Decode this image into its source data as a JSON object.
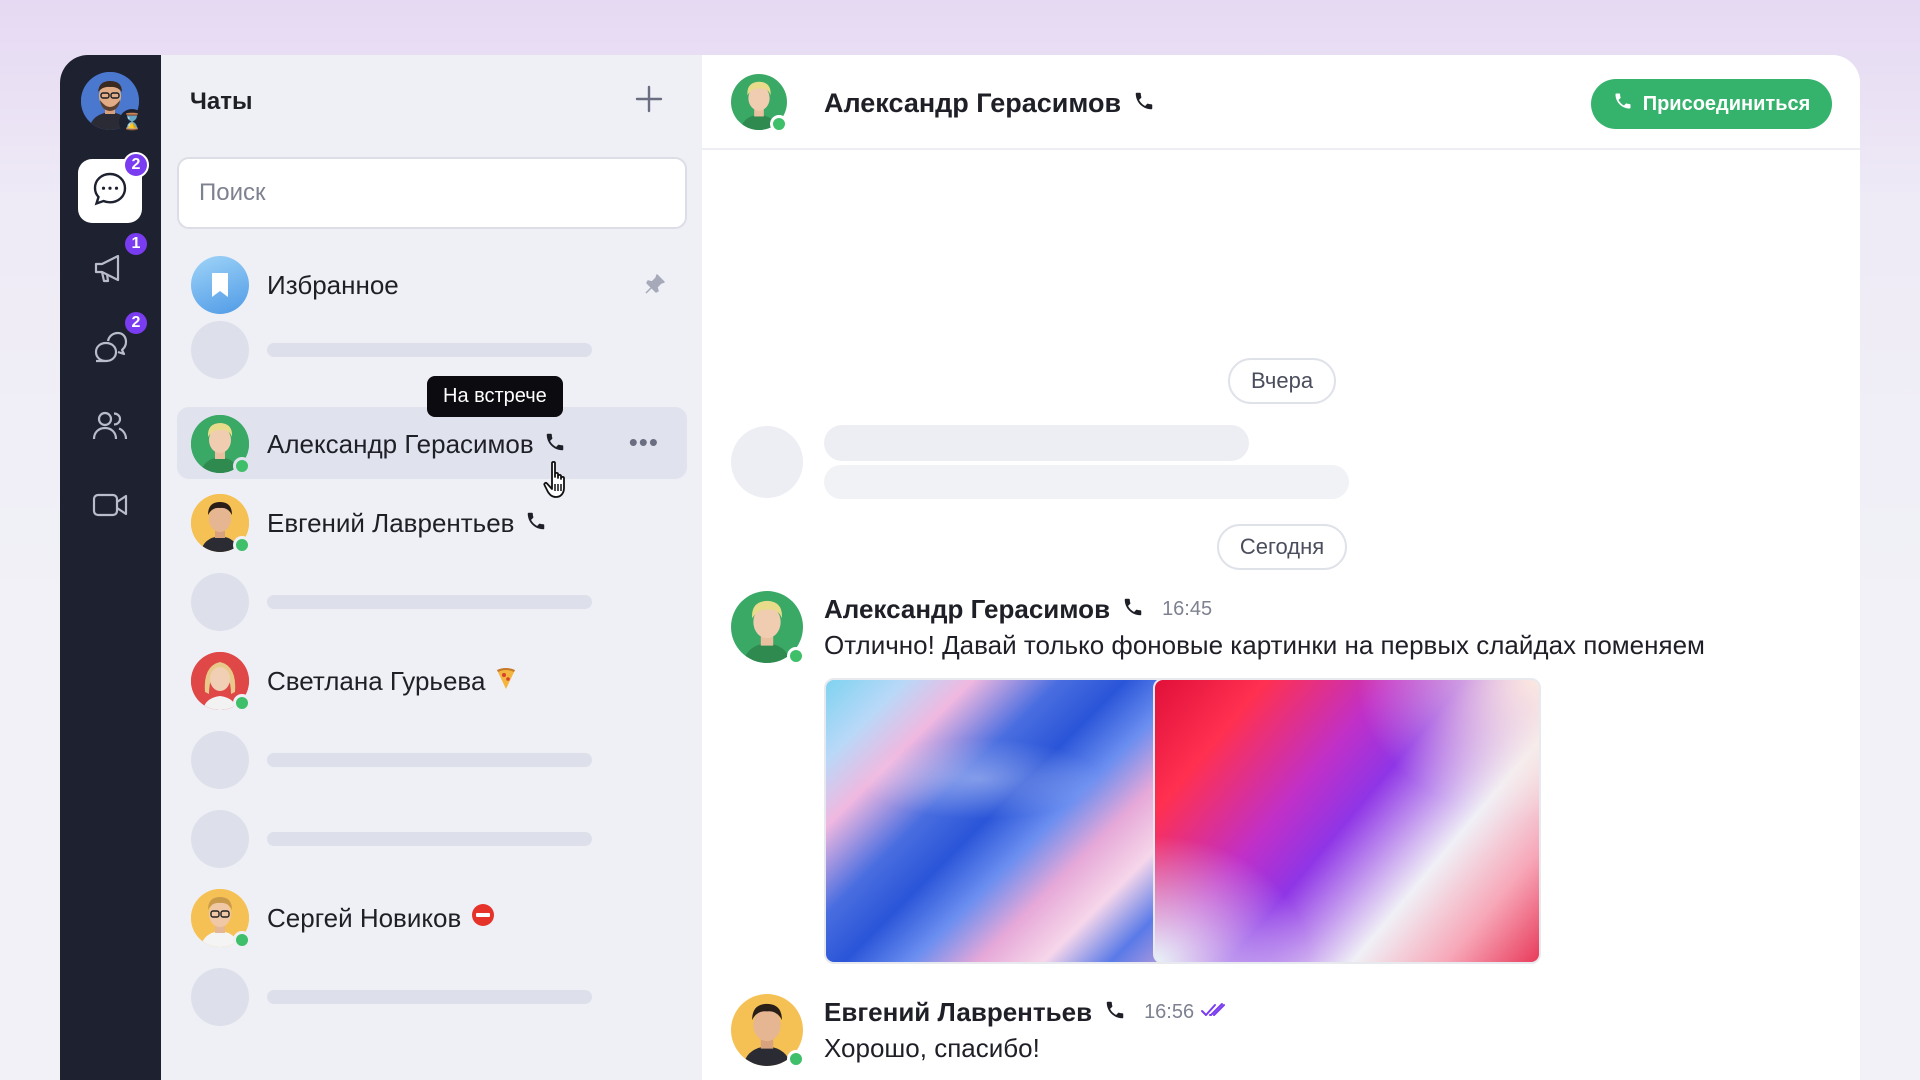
{
  "rail": {
    "avatar_status_icon": "hourglass-icon",
    "items": [
      {
        "icon": "chat-bubble-icon",
        "badge": "2",
        "active": true
      },
      {
        "icon": "megaphone-icon",
        "badge": "1",
        "active": false
      },
      {
        "icon": "threads-icon",
        "badge": "2",
        "active": false
      },
      {
        "icon": "contacts-icon",
        "badge": "",
        "active": false
      },
      {
        "icon": "video-icon",
        "badge": "",
        "active": false
      }
    ]
  },
  "chat_list": {
    "title": "Чаты",
    "search_placeholder": "Поиск",
    "favorites": {
      "name": "Избранное"
    },
    "contacts": [
      {
        "name": "Александр Герасимов",
        "status_icon": "phone-icon"
      },
      {
        "name": "Евгений Лаврентьев",
        "status_icon": "phone-icon"
      },
      {
        "name": "Светлана Гурьева",
        "status_icon": "pizza-icon"
      },
      {
        "name": "Сергей Новиков",
        "status_icon": "no-entry-icon"
      }
    ],
    "tooltip": "На встрече",
    "more_glyph": "•••"
  },
  "conversation": {
    "header_name": "Александр Герасимов",
    "join_label": "Присоединиться",
    "date_yesterday": "Вчера",
    "date_today": "Сегодня",
    "messages": [
      {
        "author": "Александр Герасимов",
        "time": "16:45",
        "text": "Отлично! Давай только фоновые картинки на первых слайдах поменяем"
      },
      {
        "author": "Евгений Лаврентьев",
        "time": "16:56",
        "text": "Хорошо, спасибо!"
      }
    ]
  },
  "colors": {
    "rail_bg": "#1e2130",
    "badge": "#7a3cf0",
    "online": "#3fbf6a",
    "join_button": "#35b36c",
    "read_checks": "#7a3cf0"
  }
}
